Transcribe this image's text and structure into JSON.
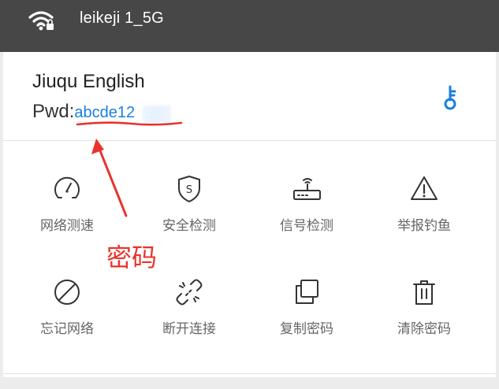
{
  "status": {
    "ssid": "leikeji 1_5G",
    "icon": "wifi-locked-icon"
  },
  "network": {
    "name": "Jiuqu English",
    "pwd_label": "Pwd:",
    "pwd_value": "abcde12",
    "key_icon": "key-icon",
    "accent_color": "#1a7fe0"
  },
  "actions": [
    {
      "label": "网络测速",
      "icon": "speedometer-icon"
    },
    {
      "label": "安全检测",
      "icon": "shield-icon"
    },
    {
      "label": "信号检测",
      "icon": "router-icon"
    },
    {
      "label": "举报钓鱼",
      "icon": "warning-icon"
    },
    {
      "label": "忘记网络",
      "icon": "forget-icon"
    },
    {
      "label": "断开连接",
      "icon": "disconnect-icon"
    },
    {
      "label": "复制密码",
      "icon": "copy-icon"
    },
    {
      "label": "清除密码",
      "icon": "trash-icon"
    }
  ],
  "annotation": {
    "text": "密码",
    "color": "#e8332c"
  }
}
